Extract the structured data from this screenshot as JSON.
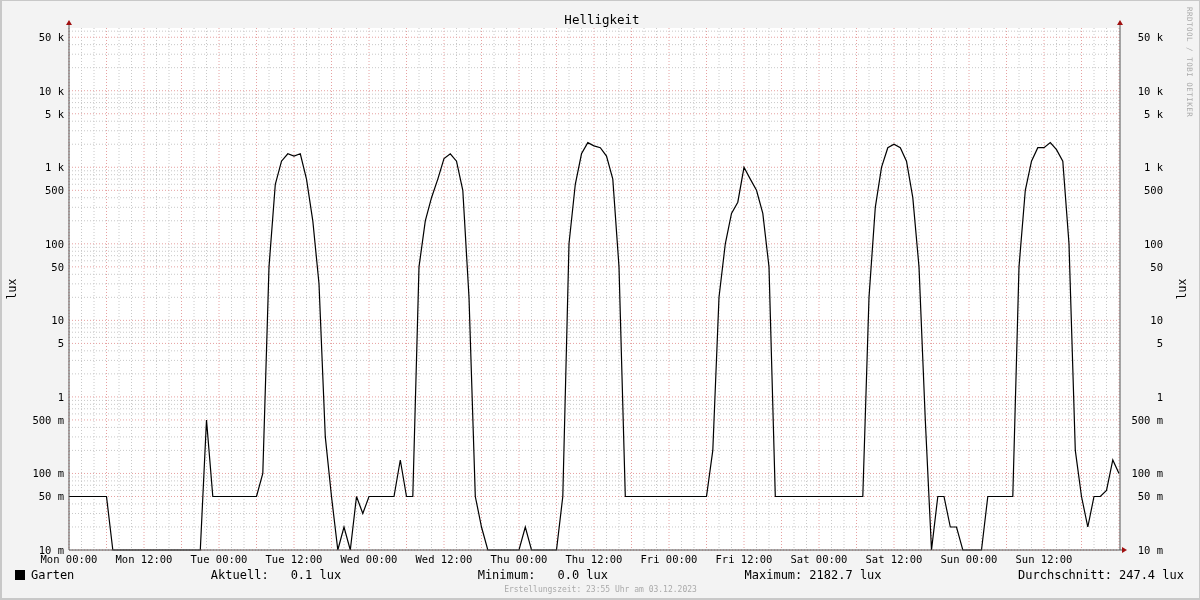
{
  "graph": {
    "title": "Helligkeit",
    "credit": "RRDTOOL / TOBI OETIKER",
    "y_axis_label": "lux",
    "right_axis_label": "lux",
    "y_tick_labels": [
      "50 k",
      "10 k",
      "5 k",
      "1 k",
      "500",
      "100",
      "50",
      "10",
      "5",
      "1",
      "500 m",
      "100 m",
      "50 m",
      "10 m"
    ],
    "right_tick_labels": [
      "50 k",
      "10 k",
      "5 k",
      "1 k",
      "500",
      "100",
      "50",
      "10",
      "5",
      "1",
      "500 m",
      "100 m",
      "50 m",
      "10 m"
    ],
    "x_tick_labels": [
      "Mon 00:00",
      "Mon 12:00",
      "Tue 00:00",
      "Tue 12:00",
      "Wed 00:00",
      "Wed 12:00",
      "Thu 00:00",
      "Thu 12:00",
      "Fri 00:00",
      "Fri 12:00",
      "Sat 00:00",
      "Sat 12:00",
      "Sun 00:00",
      "Sun 12:00"
    ]
  },
  "legend": {
    "label": "Garten",
    "color": "#000000"
  },
  "stats": [
    {
      "label": "Aktuell:",
      "value": "0.1 lux"
    },
    {
      "label": "Minimum:",
      "value": "0.0 lux"
    },
    {
      "label": "Maximum:",
      "value": "2182.7 lux"
    },
    {
      "label": "Durchschnitt:",
      "value": "247.4 lux"
    }
  ],
  "footer": "Erstellungszeit: 23:55 Uhr am 03.12.2023"
}
